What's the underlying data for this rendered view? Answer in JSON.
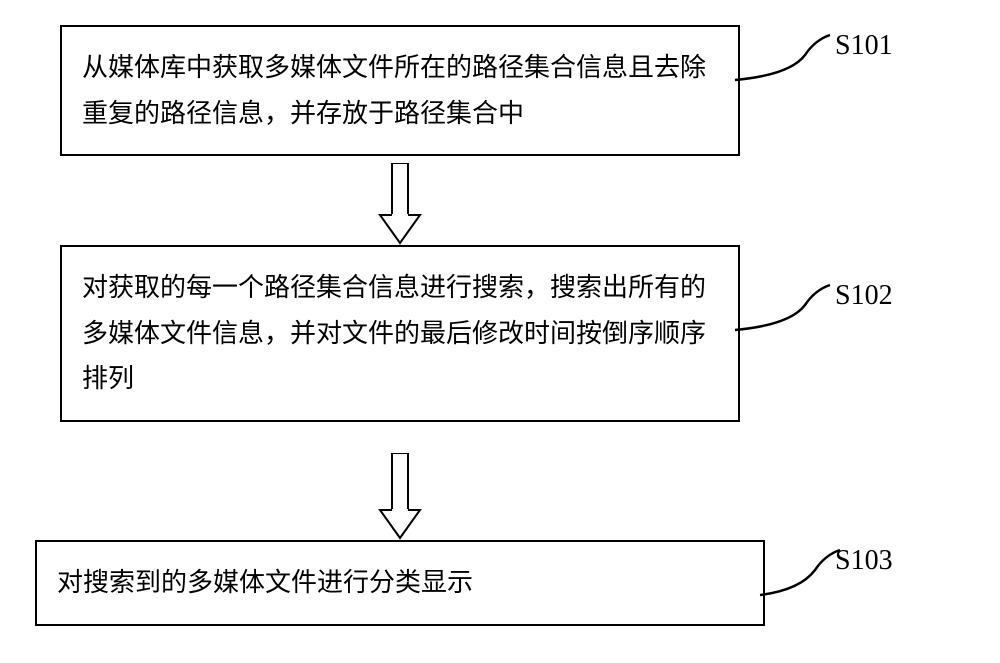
{
  "flowchart": {
    "steps": [
      {
        "id": "S101",
        "text": "从媒体库中获取多媒体文件所在的路径集合信息且去除重复的路径信息，并存放于路径集合中"
      },
      {
        "id": "S102",
        "text": "对获取的每一个路径集合信息进行搜索，搜索出所有的多媒体文件信息，并对文件的最后修改时间按倒序顺序排列"
      },
      {
        "id": "S103",
        "text": "对搜索到的多媒体文件进行分类显示"
      }
    ]
  }
}
